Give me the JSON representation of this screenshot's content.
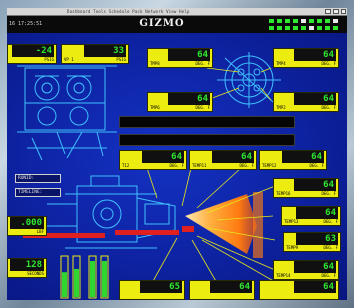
{
  "window": {
    "menubar_text": "Dashboard  Tools  Schedule  Pack  Network  View  Help",
    "title": "GIZMO",
    "timestamp": "16 17:25:51"
  },
  "gauges": {
    "top_left": {
      "value": "-24",
      "label": "",
      "unit": "PSIG"
    },
    "top_mid": {
      "value": "33",
      "label": "VP 1",
      "unit": "PSIG"
    },
    "tmp8": {
      "value": "64",
      "label": "TMP8",
      "unit": "DEG. F"
    },
    "tmp4": {
      "value": "64",
      "label": "TMP4",
      "unit": "DEG. F"
    },
    "tmp6": {
      "value": "64",
      "label": "TMP6",
      "unit": "DEG. F"
    },
    "tmp2": {
      "value": "64",
      "label": "TMP2",
      "unit": "DEG. F"
    },
    "t12": {
      "value": "64",
      "label": "T12",
      "unit": "DEG. F"
    },
    "temp11": {
      "value": "64",
      "label": "TEMP11",
      "unit": "DEG. F"
    },
    "temp12": {
      "value": "64",
      "label": "TEMP12",
      "unit": "DEG. F"
    },
    "temp16": {
      "value": "64",
      "label": "TEMP16",
      "unit": "DEG. F"
    },
    "temp13": {
      "value": "64",
      "label": "TEMP13",
      "unit": "DEG. F"
    },
    "temp9": {
      "value": "63",
      "label": "TEMP9",
      "unit": "DEG. F"
    },
    "temp14": {
      "value": "64",
      "label": "TEMP14",
      "unit": "DEG. F"
    },
    "left_mid": {
      "value": ".000",
      "label": "",
      "unit": "LBF"
    },
    "left_low": {
      "value": "128",
      "label": "",
      "unit": "SECONDS"
    },
    "bottom_a": {
      "value": "65",
      "label": "",
      "unit": ""
    },
    "bottom_b": {
      "value": "64",
      "label": "",
      "unit": ""
    },
    "bottom_c": {
      "value": "64",
      "label": "",
      "unit": ""
    }
  },
  "info": {
    "label1": "RUNID:",
    "label2": "TIMELINE:"
  },
  "colors": {
    "screen_blue": "#1432c4",
    "gauge_yellow": "#ecec10",
    "digit_green": "#2ee830",
    "schematic_cyan": "#3fc0ff",
    "flame_orange": "#ff8a1a",
    "level_green": "#2fd62f"
  },
  "levels": [
    0.62,
    0.7,
    0.9,
    0.9
  ]
}
